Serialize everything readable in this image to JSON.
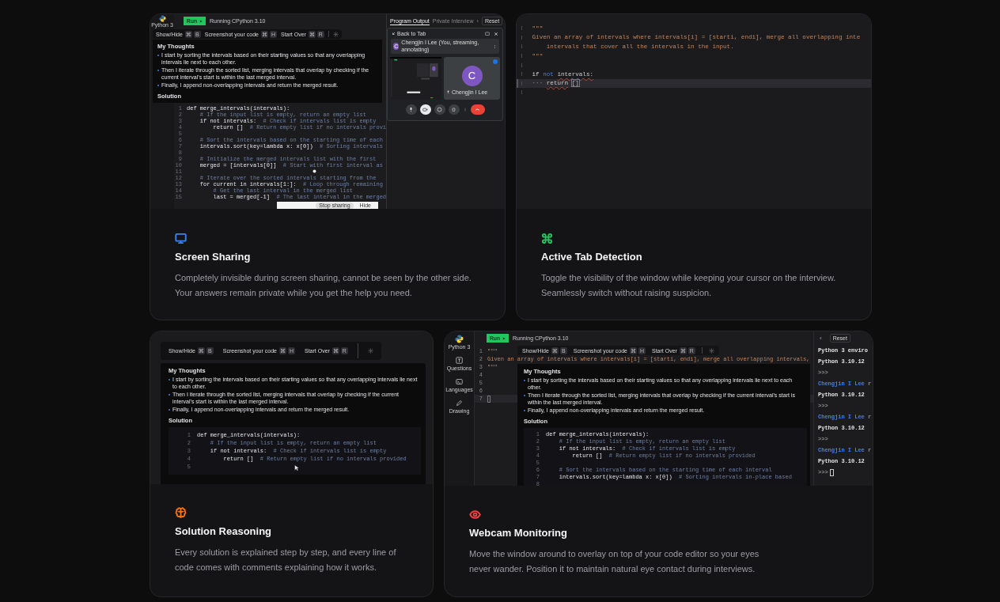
{
  "cards": [
    {
      "kind": "screen_sharing",
      "color": "#3b82f6",
      "title": "Screen Sharing",
      "description": "Completely invisible during screen sharing, cannot be seen by the other side. Your answers remain private while you get the help you need.",
      "preview": {
        "language": "Python 3",
        "run": "Run",
        "status": "Running CPython 3.10",
        "tabs": [
          {
            "label": "Program Output",
            "selected": true
          },
          {
            "label": "Private Interview",
            "selected": false
          }
        ],
        "tabs_more": "›",
        "reset": "Reset",
        "toolbar": [
          {
            "label": "Show/Hide",
            "keys": [
              "⌘",
              "B"
            ]
          },
          {
            "label": "Screenshot your code",
            "keys": [
              "⌘",
              "H"
            ]
          },
          {
            "label": "Start Over",
            "keys": [
              "⌘",
              "R"
            ]
          }
        ],
        "thoughts": {
          "heading": "My Thoughts",
          "bullets": [
            "I start by sorting the intervals based on their starting values so that any overlapping intervals lie next to each other.",
            "Then I iterate through the sorted list, merging intervals that overlap by checking if the current interval's start is within the last merged interval.",
            "Finally, I append non-overlapping intervals and return the merged result."
          ],
          "solution": "Solution"
        },
        "code": [
          {
            "n": "1",
            "code": "def merge_intervals(intervals):"
          },
          {
            "n": "2",
            "comment": "    # If the input list is empty, return an empty list"
          },
          {
            "n": "3",
            "code": "    if not intervals:",
            "comment": "# Check if intervals list is empty"
          },
          {
            "n": "4",
            "code": "        return []",
            "comment": "# Return empty list if no intervals provi"
          },
          {
            "n": "5"
          },
          {
            "n": "6",
            "comment": "    # Sort the intervals based on the starting time of each"
          },
          {
            "n": "7",
            "code": "    intervals.sort(key=lambda x: x[0])",
            "comment": "# Sorting intervals"
          },
          {
            "n": "8"
          },
          {
            "n": "9",
            "comment": "    # Initialize the merged intervals list with the first"
          },
          {
            "n": "10",
            "code": "    merged = [intervals[0]]",
            "comment": "# Start with first interval as"
          },
          {
            "n": "11"
          },
          {
            "n": "12",
            "comment": "    # Iterate over the sorted intervals starting from the"
          },
          {
            "n": "13",
            "code": "    for current in intervals[1:]:",
            "comment": "# Loop through remaining"
          },
          {
            "n": "14",
            "comment": "        # Get the last interval in the merged list"
          },
          {
            "n": "15",
            "code": "        last = merged[-1]",
            "comment": "# The last interval in the merged"
          }
        ],
        "call": {
          "back": "Back to Tab",
          "banner_initial": "C",
          "banner": "Chengjin I Lee (You, streaming, annotating)",
          "avatar": "C",
          "name": "Chengjin I Lee",
          "controls": [
            {
              "kind": "mic",
              "selected": false
            },
            {
              "kind": "camera",
              "selected": true
            },
            {
              "kind": "emoji",
              "selected": false
            },
            {
              "kind": "hand",
              "selected": false
            },
            {
              "kind": "more",
              "selected": false
            },
            {
              "kind": "end",
              "selected": false
            }
          ]
        },
        "share_bar": [
          {
            "label": "Stop sharing",
            "kind": "pill"
          },
          {
            "label": "Hide",
            "kind": "plain"
          }
        ]
      }
    },
    {
      "kind": "active_tab",
      "color": "#22c55e",
      "title": "Active Tab Detection",
      "description": "Toggle the visibility of the window while keeping your cursor on the interview. Seamlessly switch without raising suspicion.",
      "preview": {
        "lines": [
          {
            "current": false,
            "tokens": [
              {
                "text": "\"\"\"",
                "kind": "docstring"
              }
            ]
          },
          {
            "current": false,
            "tokens": [
              {
                "text": "Given an array of intervals where intervals[i] = [starti, endi], merge all overlapping inte",
                "kind": "docstring"
              }
            ]
          },
          {
            "current": false,
            "tokens": [
              {
                "text": "    intervals that cover all the intervals in the input.",
                "kind": "docstring"
              }
            ]
          },
          {
            "current": false,
            "tokens": [
              {
                "text": "\"\"\"",
                "kind": "docstring"
              }
            ]
          },
          {
            "current": false
          },
          {
            "current": false,
            "tokens": [
              {
                "text": "if",
                "kind": "plain"
              },
              {
                "text": "not",
                "kind": "keyword"
              },
              {
                "text": "intervals:",
                "kind": "error"
              }
            ]
          },
          {
            "current": true,
            "tokens": [
              {
                "text": "···",
                "kind": "whitespace"
              },
              {
                "text": "return",
                "kind": "error"
              },
              {
                "text": "[]",
                "kind": "bracket"
              }
            ]
          },
          {
            "current": false
          }
        ]
      }
    },
    {
      "kind": "reasoning",
      "color": "#f97316",
      "title": "Solution Reasoning",
      "description": "Every solution is explained step by step, and every line of code comes with comments explaining how it works.",
      "preview": {
        "toolbar": [
          {
            "label": "Show/Hide",
            "keys": [
              "⌘",
              "B"
            ]
          },
          {
            "label": "Screenshot your code",
            "keys": [
              "⌘",
              "H"
            ]
          },
          {
            "label": "Start Over",
            "keys": [
              "⌘",
              "R"
            ]
          }
        ],
        "thoughts": {
          "heading": "My Thoughts",
          "bullets": [
            "I start by sorting the intervals based on their starting values so that any overlapping intervals lie next to each other.",
            "Then I iterate through the sorted list, merging intervals that overlap by checking if the current interval's start is within the last merged interval.",
            "Finally, I append non-overlapping intervals and return the merged result."
          ],
          "solution": "Solution"
        },
        "code": [
          {
            "n": "1",
            "code": "def merge_intervals(intervals):"
          },
          {
            "n": "2",
            "comment": "    # If the input list is empty, return an empty list"
          },
          {
            "n": "3",
            "code": "    if not intervals:",
            "comment": "# Check if intervals list is empty"
          },
          {
            "n": "4",
            "code": "        return []",
            "comment": "# Return empty list if no intervals provided"
          },
          {
            "n": "5"
          }
        ]
      }
    },
    {
      "kind": "webcam",
      "color": "#ef4444",
      "title": "Webcam Monitoring",
      "description": "Move the window around to overlay on top of your code editor so your eyes never wander. Position it to maintain natural eye contact during interviews.",
      "preview": {
        "language": "Python 3",
        "run": "Run",
        "status": "Running CPython 3.10",
        "nav": [
          {
            "label": "Questions",
            "kind": "questions"
          },
          {
            "label": "Languages",
            "kind": "terminal"
          },
          {
            "label": "Drawing",
            "kind": "pen"
          }
        ],
        "editor": [
          {
            "n": "1",
            "text": "\"\"\"",
            "current": false
          },
          {
            "n": "2",
            "text": "Given an array of intervals where intervals[i] = [starti, endi], merge all overlapping intervals,",
            "current": false
          },
          {
            "n": "3",
            "text": "\"\"\"",
            "current": false
          },
          {
            "n": "4",
            "current": false
          },
          {
            "n": "5",
            "current": false
          },
          {
            "n": "6",
            "current": false
          },
          {
            "n": "7",
            "current": true
          }
        ],
        "back": "‹",
        "reset": "Reset",
        "output": [
          {
            "kind": "text",
            "text": "Python 3 enviro"
          },
          {
            "kind": "text",
            "text": "Python 3.10.12"
          },
          {
            "kind": "prompt",
            "text": ">>>"
          },
          {
            "kind": "user",
            "name": "Chengjin I Lee",
            "text": "r"
          },
          {
            "kind": "text",
            "text": "Python 3.10.12"
          },
          {
            "kind": "prompt",
            "text": ">>>"
          },
          {
            "kind": "user",
            "name": "Chengjin I Lee",
            "text": "r"
          },
          {
            "kind": "text",
            "text": "Python 3.10.12"
          },
          {
            "kind": "prompt",
            "text": ">>>"
          },
          {
            "kind": "user",
            "name": "Chengjin I Lee",
            "text": "r"
          },
          {
            "kind": "text",
            "text": "Python 3.10.12"
          },
          {
            "kind": "input",
            "text": ">>>"
          }
        ],
        "toolbar": [
          {
            "label": "Show/Hide",
            "keys": [
              "⌘",
              "B"
            ]
          },
          {
            "label": "Screenshot your code",
            "keys": [
              "⌘",
              "H"
            ]
          },
          {
            "label": "Start Over",
            "keys": [
              "⌘",
              "R"
            ]
          }
        ],
        "thoughts": {
          "heading": "My Thoughts",
          "bullets": [
            "I start by sorting the intervals based on their starting values so that any overlapping intervals lie next to each other.",
            "Then I iterate through the sorted list, merging intervals that overlap by checking if the current interval's start is within the last merged interval.",
            "Finally, I append non-overlapping intervals and return the merged result."
          ],
          "solution": "Solution"
        },
        "code": [
          {
            "n": "1",
            "code": "def merge_intervals(intervals):"
          },
          {
            "n": "2",
            "comment": "    # If the input list is empty, return an empty list"
          },
          {
            "n": "3",
            "code": "    if not intervals:",
            "comment": "# Check if intervals list is empty"
          },
          {
            "n": "4",
            "code": "        return []",
            "comment": "# Return empty list if no intervals provided"
          },
          {
            "n": "5"
          },
          {
            "n": "6",
            "comment": "    # Sort the intervals based on the starting time of each interval"
          },
          {
            "n": "7",
            "code": "    intervals.sort(key=lambda x: x[0])",
            "comment": "# Sorting intervals in-place based"
          },
          {
            "n": "8"
          }
        ]
      }
    }
  ]
}
